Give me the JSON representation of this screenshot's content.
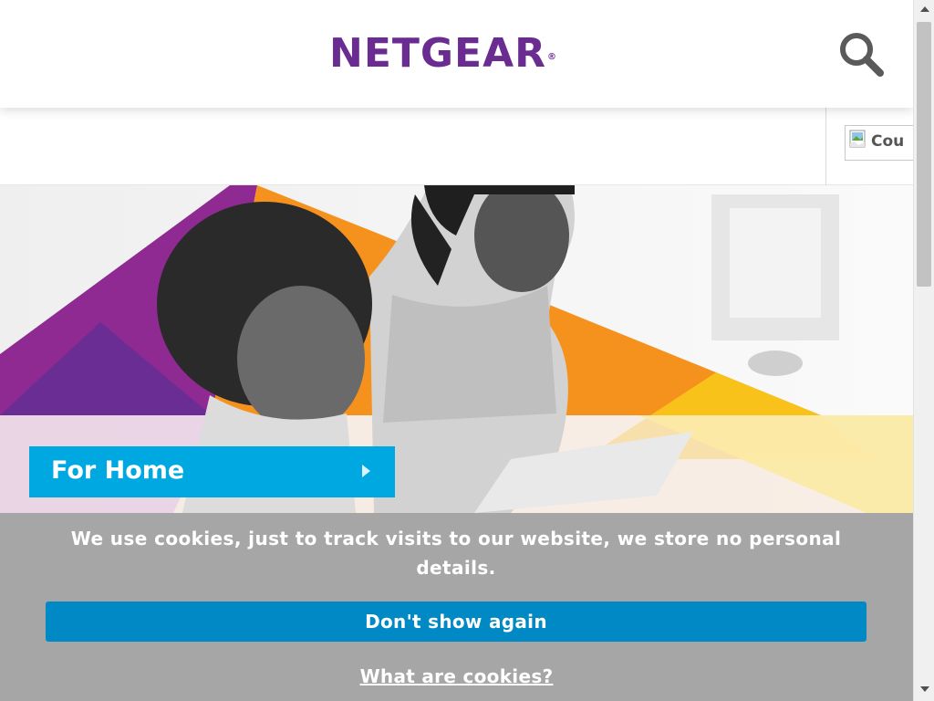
{
  "header": {
    "logo_text": "NETGEAR",
    "logo_mark": "®",
    "search_icon": "search-icon"
  },
  "country_selector": {
    "alt_text": "Cou",
    "icon": "broken-image-icon"
  },
  "hero": {
    "image": "mother-and-daughter-photo",
    "cta_label": "For Home",
    "cta_icon": "chevron-right-icon"
  },
  "cookie_banner": {
    "message": "We use cookies, just to track visits to our website, we store no personal details.",
    "dismiss_label": "Don't show again",
    "info_link": "What are cookies?"
  },
  "colors": {
    "brand_purple": "#6b2c91",
    "cta_blue": "#00a8e1",
    "cookie_button": "#0089c4",
    "cookie_bg": "#a6a6a6",
    "accent_orange": "#f5921e"
  },
  "scrollbar": {
    "up_icon": "arrow-up-icon",
    "down_icon": "arrow-down-icon"
  }
}
